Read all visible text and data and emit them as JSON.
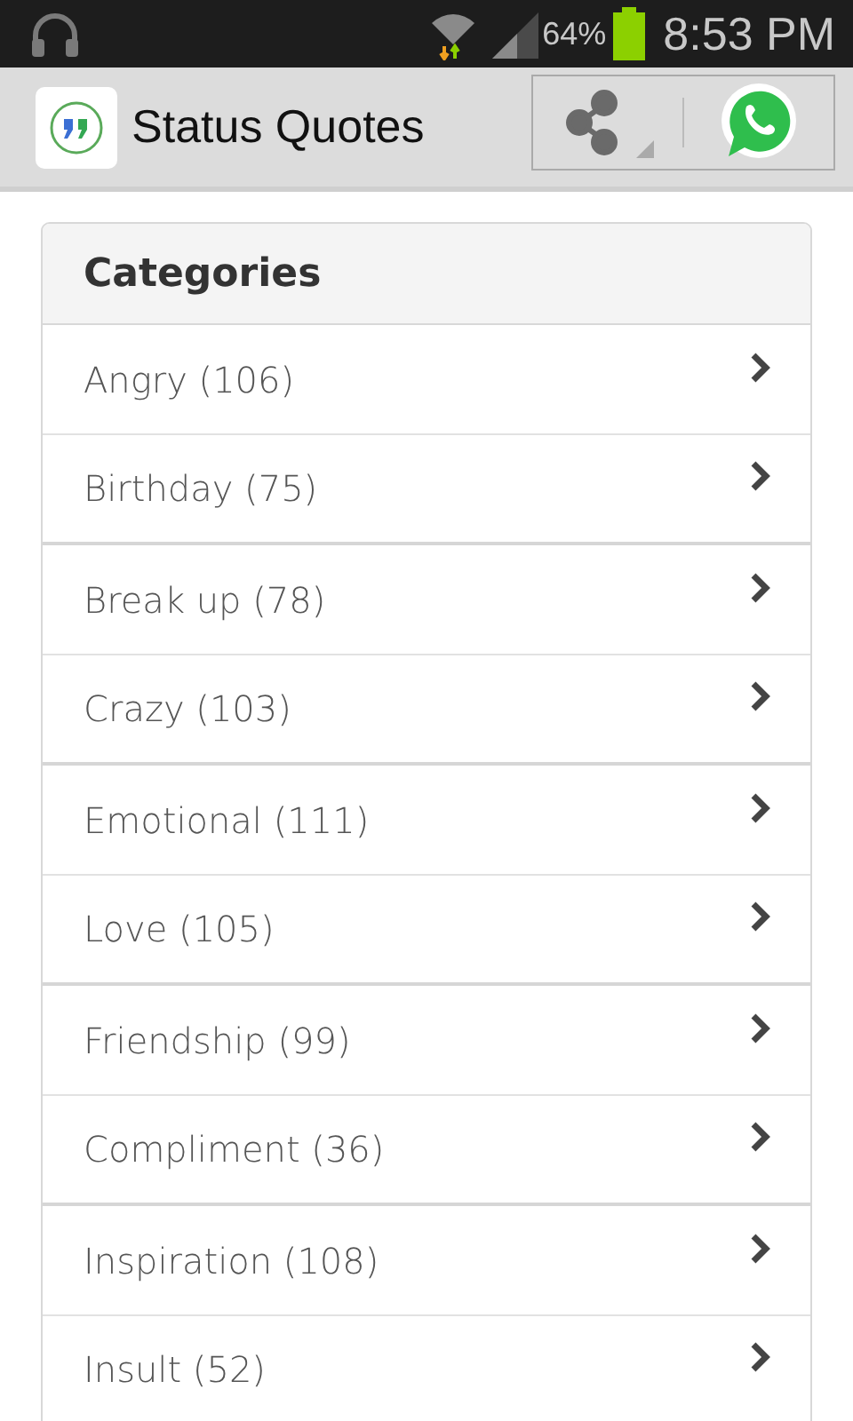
{
  "status_bar": {
    "battery": "64%",
    "time": "8:53 PM"
  },
  "app_bar": {
    "title": "Status Quotes"
  },
  "categories": {
    "title": "Categories",
    "items": [
      {
        "label": "Angry (106)"
      },
      {
        "label": "Birthday (75)"
      },
      {
        "label": "Break up (78)"
      },
      {
        "label": "Crazy (103)"
      },
      {
        "label": "Emotional (111)"
      },
      {
        "label": "Love (105)"
      },
      {
        "label": "Friendship (99)"
      },
      {
        "label": "Compliment (36)"
      },
      {
        "label": "Inspiration (108)"
      },
      {
        "label": "Insult (52)"
      }
    ]
  }
}
